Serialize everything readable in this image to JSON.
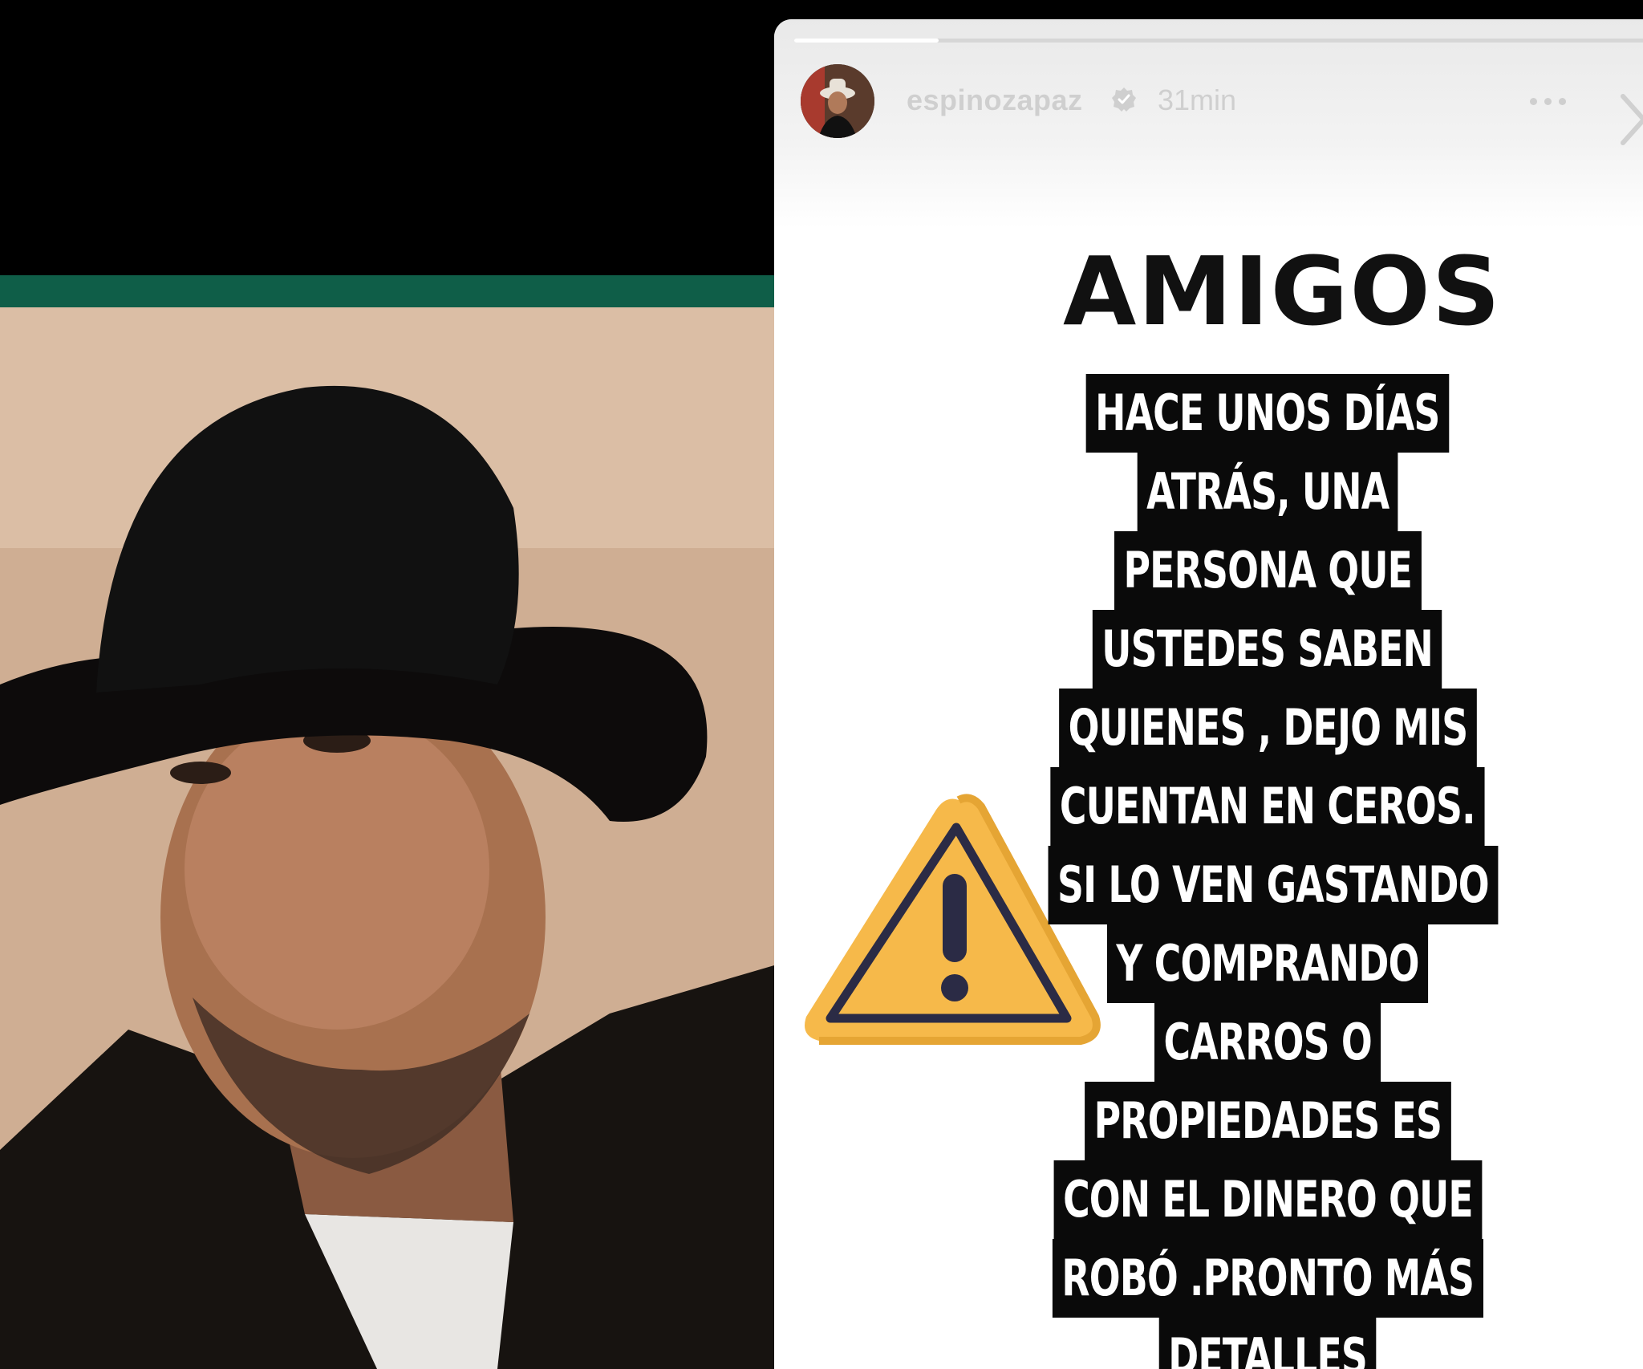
{
  "story": {
    "username": "espinozapaz",
    "time_ago": "31min",
    "headline": "AMIGOS",
    "progress": 0.17,
    "lines": [
      "HACE UNOS DÍAS",
      "ATRÁS, UNA",
      "PERSONA QUE",
      "USTEDES SABEN",
      "QUIENES , DEJO MIS",
      "CUENTAN EN CEROS.",
      "SI LO VEN GASTANDO",
      "Y COMPRANDO",
      "CARROS O",
      "PROPIEDADES ES",
      "CON EL DINERO QUE",
      "ROBÓ .PRONTO MÁS",
      "DETALLES"
    ]
  },
  "icons": {
    "verified": "verified-badge-icon",
    "more": "more-horizontal-icon",
    "next": "chevron-right-icon",
    "warning": "warning-triangle-icon"
  },
  "colors": {
    "green_band": "#0f5e48",
    "warning_fill": "#f6b94a",
    "warning_stroke": "#2b2b45"
  }
}
